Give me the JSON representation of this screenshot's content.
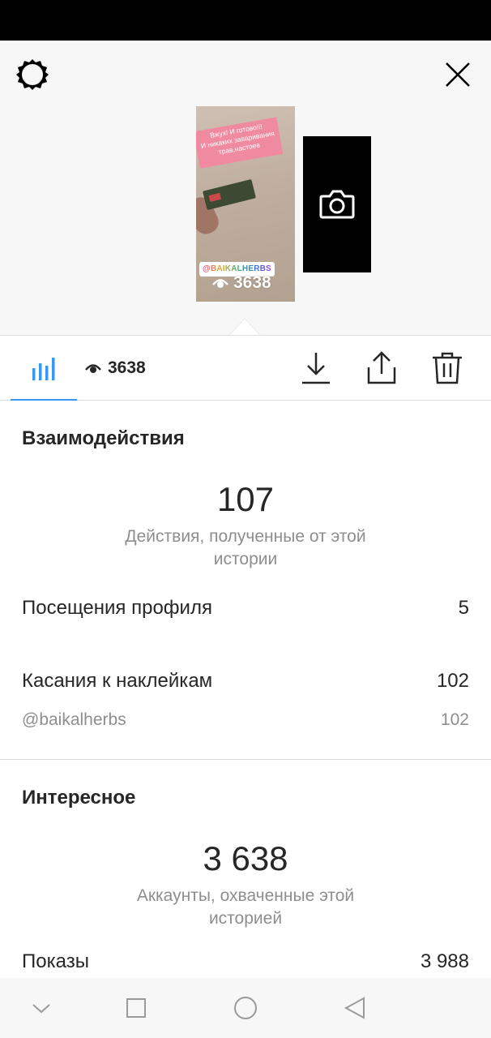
{
  "story": {
    "caption_line1": "Вжух! И готово!!!",
    "caption_line2": "И никаких заваривания",
    "caption_line3": "трав,настоев",
    "mention": "@BAIKALHERBS",
    "views": "3638"
  },
  "toolbar": {
    "viewers_count": "3638"
  },
  "interactions": {
    "title": "Взаимодействия",
    "total": "107",
    "total_caption": "Действия, полученные от этой истории",
    "profile_visits_label": "Посещения профиля",
    "profile_visits_value": "5",
    "sticker_taps_label": "Касания к наклейкам",
    "sticker_taps_value": "102",
    "sticker_mention_label": "@baikalherbs",
    "sticker_mention_value": "102"
  },
  "discovery": {
    "title": "Интересное",
    "total": "3 638",
    "total_caption": "Аккаунты, охваченные этой историей",
    "impressions_label": "Показы",
    "impressions_value": "3 988"
  },
  "colors": {
    "accent": "#3897f0",
    "text_primary": "#262626",
    "text_secondary": "#8e8e8e"
  }
}
